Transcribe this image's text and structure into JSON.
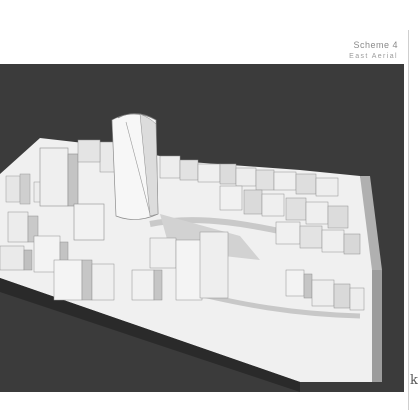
{
  "sheet": {
    "scheme_title": "Scheme 4",
    "view_title": "East Aerial",
    "logo_letter": "k"
  },
  "colors": {
    "viewport_bg": "#3b3b3b",
    "model_top": "#f2f2f2",
    "model_side": "#9a9a9a",
    "building_light": "#f5f5f5",
    "building_mid": "#d4d4d4",
    "building_dark": "#a8a8a8",
    "shadow": "#bdbdbd"
  }
}
